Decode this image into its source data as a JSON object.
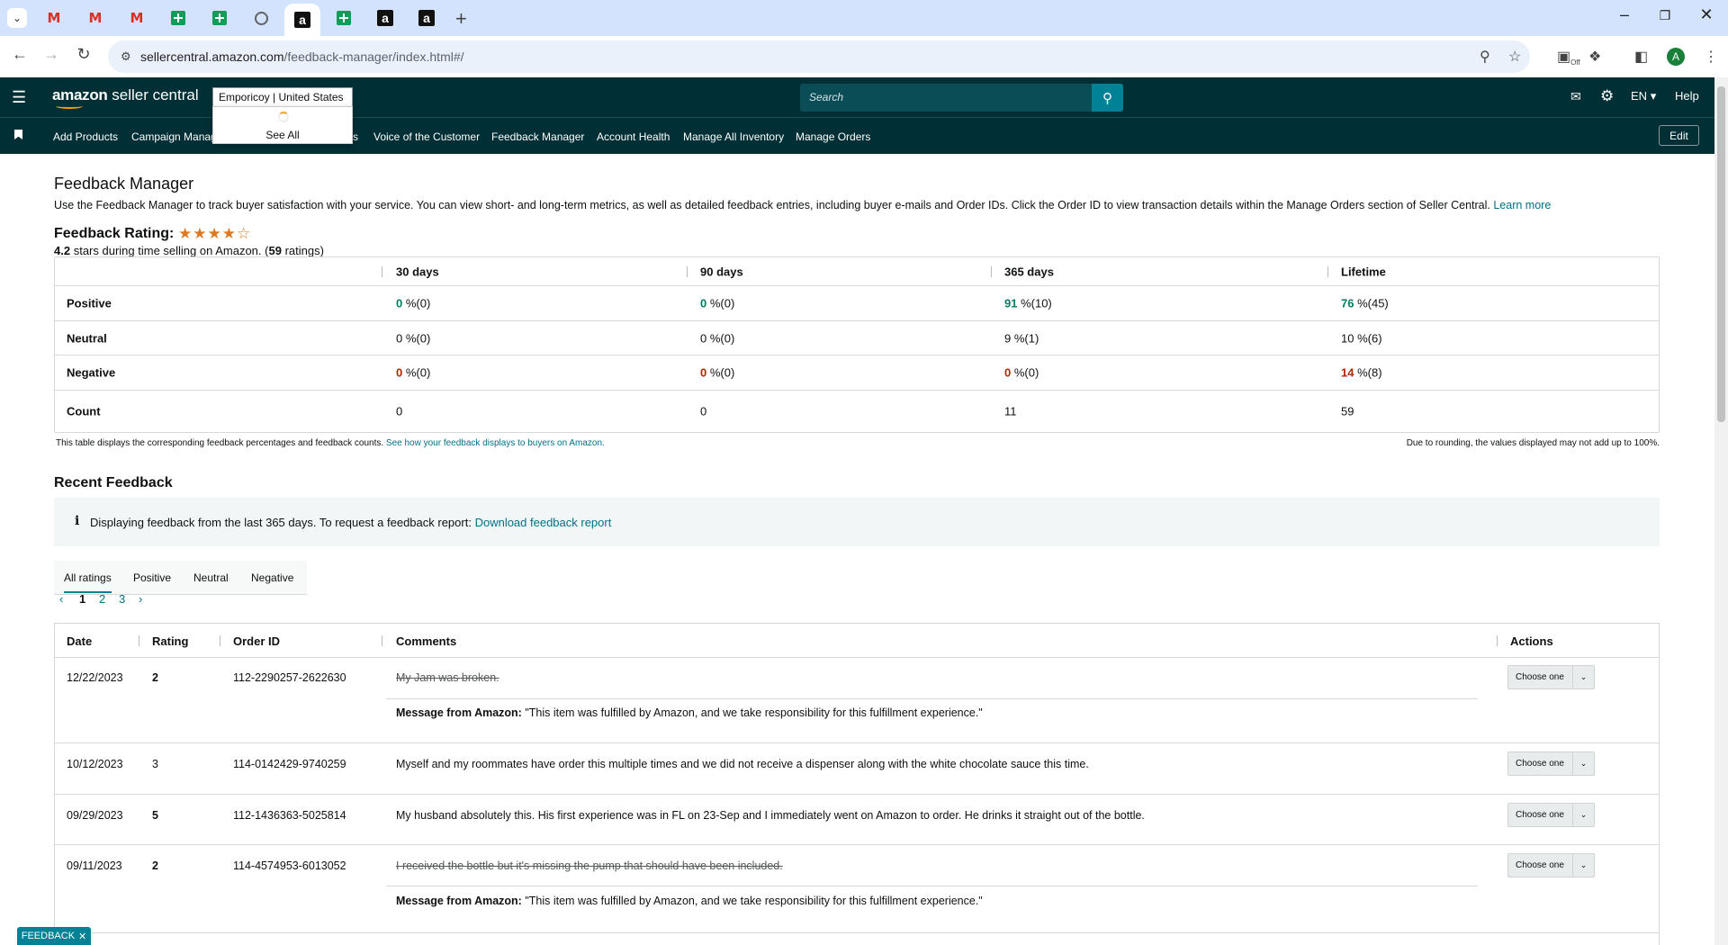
{
  "browser": {
    "url_host": "sellercentral.amazon.com",
    "url_path": "/feedback-manager/index.html#/",
    "profile_initial": "A",
    "ext_badge": "Off"
  },
  "header": {
    "logo_brand": "amazon",
    "logo_suffix": "seller central",
    "account_name": "Emporicoy",
    "account_region": "United States",
    "search_placeholder": "Search",
    "language": "EN",
    "help": "Help",
    "see_all": "See All"
  },
  "nav": {
    "items": [
      "Add Products",
      "Campaign Manag",
      "s",
      "Voice of the Customer",
      "Feedback Manager",
      "Account Health",
      "Manage All Inventory",
      "Manage Orders"
    ],
    "edit": "Edit"
  },
  "page": {
    "title": "Feedback Manager",
    "intro": "Use the Feedback Manager to track buyer satisfaction with your service. You can view short- and long-term metrics, as well as detailed feedback entries, including buyer e-mails and Order IDs. Click the Order ID to view transaction details within the Manage Orders section of Seller Central.",
    "learn_more": "Learn more",
    "rating_title": "Feedback Rating:",
    "stars_value": 4.2,
    "stars_max": 5,
    "rating_stars": "4.2",
    "rating_desc": "stars during time selling on Amazon. (",
    "rating_count": "59",
    "rating_suffix": " ratings)"
  },
  "metrics": {
    "columns": [
      "30 days",
      "90 days",
      "365 days",
      "Lifetime"
    ],
    "rows": [
      {
        "label": "Positive",
        "cells": [
          {
            "num": "0",
            "rest": " %(0)"
          },
          {
            "num": "0",
            "rest": " %(0)"
          },
          {
            "num": "91",
            "rest": " %(10)"
          },
          {
            "num": "76",
            "rest": " %(45)"
          }
        ]
      },
      {
        "label": "Neutral",
        "cells": [
          {
            "num": "0",
            "rest": " %(0)"
          },
          {
            "num": "0",
            "rest": " %(0)"
          },
          {
            "num": "9",
            "rest": " %(1)"
          },
          {
            "num": "10",
            "rest": " %(6)"
          }
        ]
      },
      {
        "label": "Negative",
        "cells": [
          {
            "num": "0",
            "rest": " %(0)"
          },
          {
            "num": "0",
            "rest": " %(0)"
          },
          {
            "num": "0",
            "rest": " %(0)"
          },
          {
            "num": "14",
            "rest": " %(8)"
          }
        ]
      },
      {
        "label": "Count",
        "cells": [
          {
            "num": "0",
            "rest": ""
          },
          {
            "num": "0",
            "rest": ""
          },
          {
            "num": "11",
            "rest": ""
          },
          {
            "num": "59",
            "rest": ""
          }
        ]
      }
    ],
    "footnote_left": "This table displays the corresponding feedback percentages and feedback counts.",
    "footnote_link": "See how your feedback displays to buyers on Amazon.",
    "footnote_right": "Due to rounding, the values displayed may not add up to 100%."
  },
  "recent": {
    "title": "Recent Feedback",
    "alert_icon": "i",
    "alert_text": "Displaying feedback from the last 365 days. To request a feedback report:",
    "alert_link": "Download feedback report",
    "tabs": [
      "All ratings",
      "Positive",
      "Neutral",
      "Negative"
    ],
    "pages": [
      "1",
      "2",
      "3"
    ],
    "columns": [
      "Date",
      "Rating",
      "Order ID",
      "Comments",
      "Actions"
    ],
    "message_prefix": "Message from Amazon:",
    "action_label": "Choose one",
    "rows": [
      {
        "date": "12/22/2023",
        "rating": "2",
        "order": "112-2290257-2622630",
        "comment": "My Jam was broken.",
        "struck": true,
        "message": "\"This item was fulfilled by Amazon, and we take responsibility for this fulfillment experience.\""
      },
      {
        "date": "10/12/2023",
        "rating": "3",
        "order": "114-0142429-9740259",
        "comment": "Myself and my roommates have order this multiple times and we did not receive a dispenser along with the white chocolate sauce this time.",
        "struck": false,
        "message": ""
      },
      {
        "date": "09/29/2023",
        "rating": "5",
        "order": "112-1436363-5025814",
        "comment": "My husband absolutely this. His first experience was in FL on 23-Sep and I immediately went on Amazon to order. He drinks it straight out of the bottle.",
        "struck": false,
        "message": ""
      },
      {
        "date": "09/11/2023",
        "rating": "2",
        "order": "114-4574953-6013052",
        "comment": "I received the bottle but it's missing the pump that should have been included.",
        "struck": true,
        "message": "\"This item was fulfilled by Amazon, and we take responsibility for this fulfillment experience.\""
      }
    ]
  },
  "feedback_tab": "FEEDBACK",
  "colors": {
    "header_bg": "#002f36",
    "link": "#007185",
    "positive": "#067d62",
    "negative": "#b12704",
    "star": "#de7921",
    "accent": "#008296"
  }
}
